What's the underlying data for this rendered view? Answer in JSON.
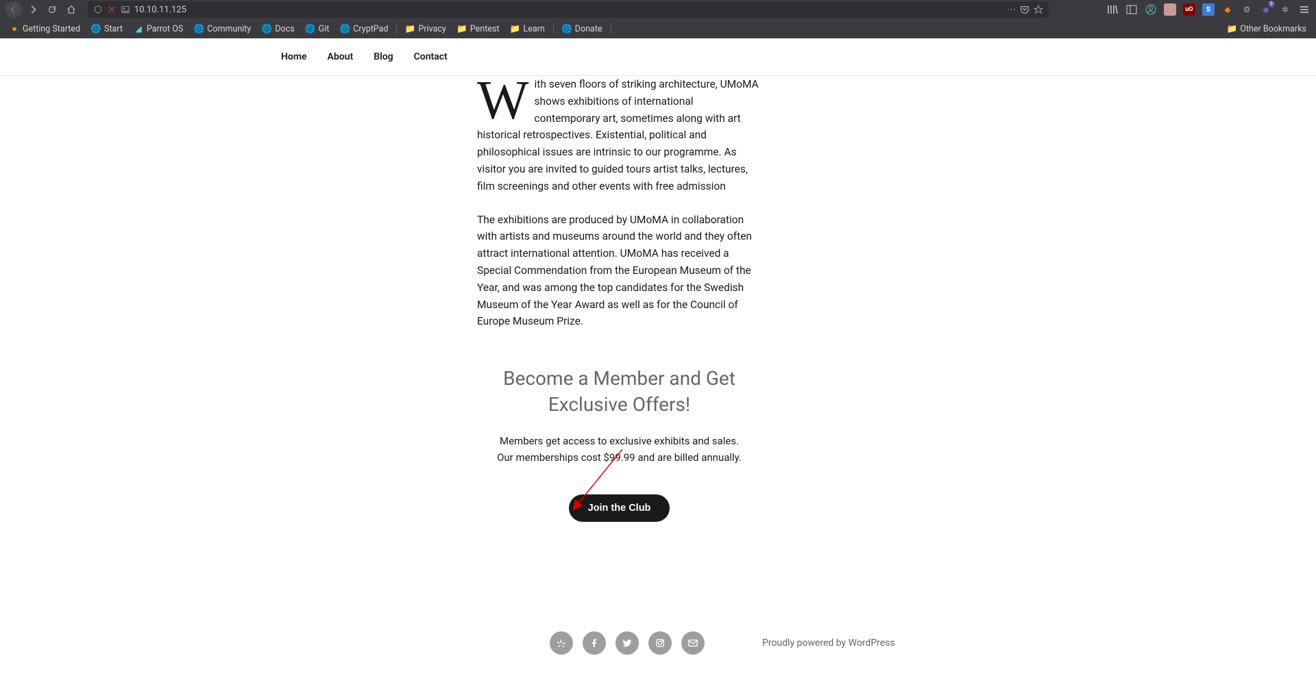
{
  "browser": {
    "url": "10.10.11.125",
    "bookmarks": [
      {
        "label": "Getting Started",
        "icon": "firefox"
      },
      {
        "label": "Start",
        "icon": "globe"
      },
      {
        "label": "Parrot OS",
        "icon": "parrot"
      },
      {
        "label": "Community",
        "icon": "globe"
      },
      {
        "label": "Docs",
        "icon": "globe"
      },
      {
        "label": "Git",
        "icon": "globe"
      },
      {
        "label": "CryptPad",
        "icon": "globe"
      },
      {
        "label": "Privacy",
        "icon": "folder"
      },
      {
        "label": "Pentest",
        "icon": "folder"
      },
      {
        "label": "Learn",
        "icon": "folder"
      },
      {
        "label": "Donate",
        "icon": "globe"
      }
    ],
    "other_bookmarks": "Other Bookmarks",
    "ext_badge": "9"
  },
  "nav": {
    "items": [
      "Home",
      "About",
      "Blog",
      "Contact"
    ]
  },
  "content": {
    "drop_cap": "W",
    "para1": "ith seven floors of striking architecture, UMoMA shows exhibitions of international contemporary art, sometimes along with art historical retrospectives. Existential, political and philosophical issues are intrinsic to our programme. As visitor you are invited to guided tours artist talks, lectures, film screenings and other events with free admission",
    "para2": "The exhibitions are produced by UMoMA in collaboration with artists and museums around the world and they often attract international attention. UMoMA has received a Special Commendation from the European Museum of the Year, and was among the top candidates for the Swedish Museum of the Year Award as well as for the Council of Europe Museum Prize."
  },
  "member": {
    "title": "Become a Member and Get Exclusive Offers!",
    "text": "Members get access to exclusive exhibits and sales. Our memberships cost $99.99 and are billed annually.",
    "button": "Join the Club"
  },
  "footer": {
    "powered": "Proudly powered by WordPress"
  }
}
